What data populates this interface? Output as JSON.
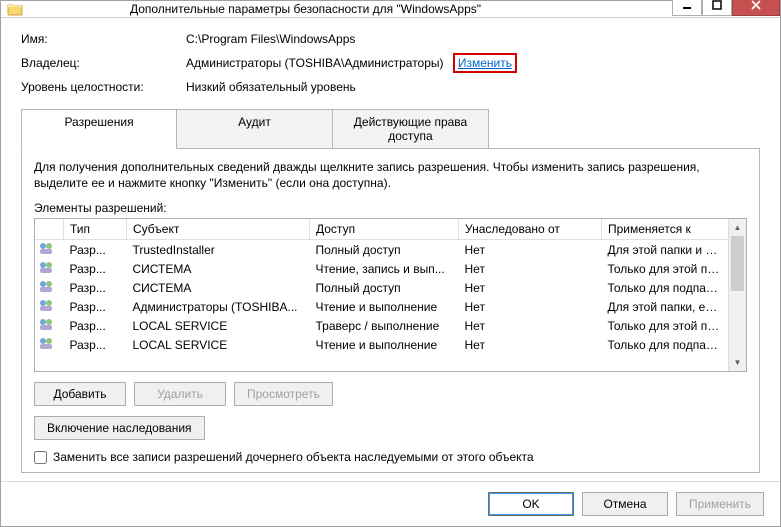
{
  "window": {
    "title": "Дополнительные параметры безопасности  для \"WindowsApps\""
  },
  "info": {
    "name_label": "Имя:",
    "name_value": "C:\\Program Files\\WindowsApps",
    "owner_label": "Владелец:",
    "owner_value": "Администраторы (TOSHIBA\\Администраторы)",
    "owner_change": "Изменить",
    "integrity_label": "Уровень целостности:",
    "integrity_value": "Низкий обязательный уровень"
  },
  "tabs": {
    "permissions": "Разрешения",
    "audit": "Аудит",
    "effective": "Действующие права доступа"
  },
  "instructions": "Для получения дополнительных сведений дважды щелкните запись разрешения. Чтобы изменить запись разрешения, выделите ее и нажмите кнопку \"Изменить\" (если она доступна).",
  "perm_label": "Элементы разрешений:",
  "columns": {
    "type": "Тип",
    "subject": "Субъект",
    "access": "Доступ",
    "inherited": "Унаследовано от",
    "applies": "Применяется к"
  },
  "rows": [
    {
      "type": "Разр...",
      "subject": "TrustedInstaller",
      "access": "Полный доступ",
      "inherited": "Нет",
      "applies": "Для этой папки и ее подпап..."
    },
    {
      "type": "Разр...",
      "subject": "СИСТЕМА",
      "access": "Чтение, запись и вып...",
      "inherited": "Нет",
      "applies": "Только для этой папки"
    },
    {
      "type": "Разр...",
      "subject": "СИСТЕМА",
      "access": "Полный доступ",
      "inherited": "Нет",
      "applies": "Только для подпапок и фай..."
    },
    {
      "type": "Разр...",
      "subject": "Администраторы (TOSHIBA...",
      "access": "Чтение и выполнение",
      "inherited": "Нет",
      "applies": "Для этой папки, ее подпап..."
    },
    {
      "type": "Разр...",
      "subject": "LOCAL SERVICE",
      "access": "Траверс / выполнение",
      "inherited": "Нет",
      "applies": "Только для этой папки"
    },
    {
      "type": "Разр...",
      "subject": "LOCAL SERVICE",
      "access": "Чтение и выполнение",
      "inherited": "Нет",
      "applies": "Только для подпапок и фай..."
    }
  ],
  "buttons": {
    "add": "Добавить",
    "remove": "Удалить",
    "view": "Просмотреть",
    "enable_inherit": "Включение наследования",
    "replace_checkbox": "Заменить все записи разрешений дочернего объекта наследуемыми от этого объекта",
    "ok": "OK",
    "cancel": "Отмена",
    "apply": "Применить"
  }
}
